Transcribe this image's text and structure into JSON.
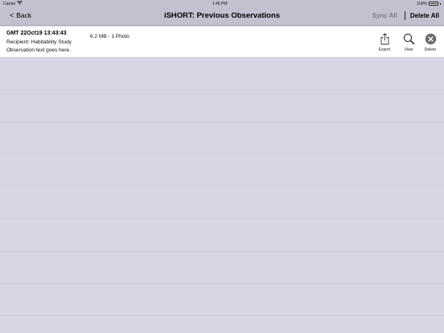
{
  "status_bar": {
    "carrier": "Carrier",
    "time": "1:45 PM",
    "battery": "100%"
  },
  "nav": {
    "back_label": "Back",
    "title": "iSHORT: Previous Observations",
    "sync_all_label": "Sync All",
    "delete_all_label": "Delete All"
  },
  "observation": {
    "timestamp": "GMT 22Oct19 13:43:43",
    "recipient": "Recipient: Habitability Study",
    "text": "Observation text goes here.",
    "size": "6.2 MB - 1 Photo",
    "actions": {
      "export_label": "Export",
      "view_label": "View",
      "delete_label": "Delete"
    }
  },
  "icons": {
    "back": "chevron-left-icon",
    "wifi": "wifi-icon",
    "battery": "battery-icon",
    "export": "share-icon",
    "view": "magnifier-icon",
    "delete": "close-circle-icon"
  },
  "colors": {
    "nav_background": "#c2c1cf",
    "page_background": "#d8d6e3",
    "disabled_text": "#7d7c88"
  }
}
